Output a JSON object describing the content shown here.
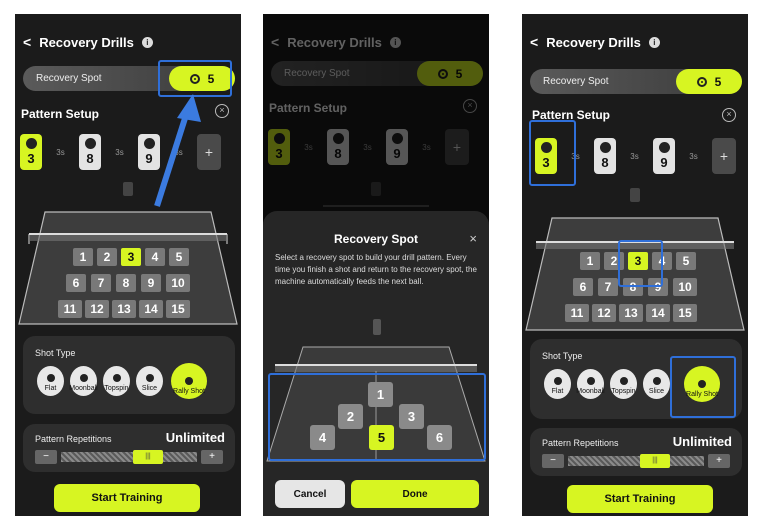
{
  "header": {
    "title": "Recovery Drills",
    "back_glyph": "<",
    "info_glyph": "i"
  },
  "recovery": {
    "label": "Recovery Spot",
    "value": "5"
  },
  "pattern": {
    "title": "Pattern Setup",
    "close_glyph": "×",
    "cards": [
      "3",
      "8",
      "9"
    ],
    "gap_label": "3s",
    "add_glyph": "+"
  },
  "zones": [
    "1",
    "2",
    "3",
    "4",
    "5",
    "6",
    "7",
    "8",
    "9",
    "10",
    "11",
    "12",
    "13",
    "14",
    "15"
  ],
  "shot_type": {
    "title": "Shot Type",
    "shots": [
      "Flat",
      "Moonball",
      "Topspin",
      "Slice",
      "Rally Shot"
    ]
  },
  "repetitions": {
    "title": "Pattern Repetitions",
    "value": "Unlimited",
    "minus": "−",
    "plus": "+",
    "thumb": "|||"
  },
  "start_label": "Start Training",
  "modal": {
    "title": "Recovery Spot",
    "close_glyph": "×",
    "description": "Select a recovery spot to build your drill pattern. Every time you finish a shot and return to the recovery spot, the machine automatically feeds the next ball.",
    "spots": [
      "1",
      "2",
      "3",
      "4",
      "5",
      "6"
    ],
    "selected_spot": "5",
    "cancel_label": "Cancel",
    "done_label": "Done"
  },
  "colors": {
    "accent": "#d7f522",
    "highlight": "#2f6fd9",
    "background": "#1b1b1b"
  },
  "icons": [
    "back-chevron-icon",
    "info-icon",
    "ball-icon",
    "close-circle-icon",
    "plus-icon",
    "arrow-icon"
  ]
}
